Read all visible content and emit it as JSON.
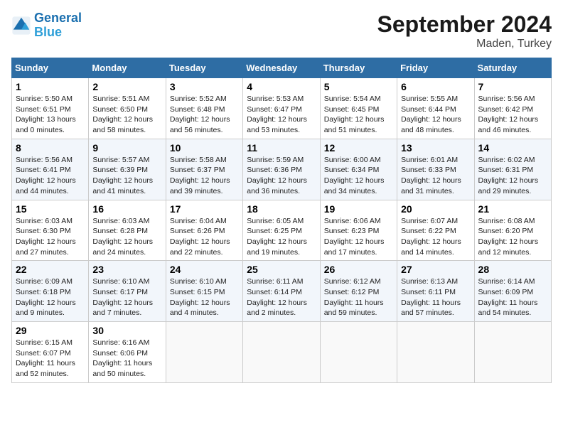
{
  "header": {
    "logo_line1": "General",
    "logo_line2": "Blue",
    "month_title": "September 2024",
    "location": "Maden, Turkey"
  },
  "days_of_week": [
    "Sunday",
    "Monday",
    "Tuesday",
    "Wednesday",
    "Thursday",
    "Friday",
    "Saturday"
  ],
  "weeks": [
    [
      {
        "num": "1",
        "rise": "5:50 AM",
        "set": "6:51 PM",
        "daylight": "13 hours and 0 minutes."
      },
      {
        "num": "2",
        "rise": "5:51 AM",
        "set": "6:50 PM",
        "daylight": "12 hours and 58 minutes."
      },
      {
        "num": "3",
        "rise": "5:52 AM",
        "set": "6:48 PM",
        "daylight": "12 hours and 56 minutes."
      },
      {
        "num": "4",
        "rise": "5:53 AM",
        "set": "6:47 PM",
        "daylight": "12 hours and 53 minutes."
      },
      {
        "num": "5",
        "rise": "5:54 AM",
        "set": "6:45 PM",
        "daylight": "12 hours and 51 minutes."
      },
      {
        "num": "6",
        "rise": "5:55 AM",
        "set": "6:44 PM",
        "daylight": "12 hours and 48 minutes."
      },
      {
        "num": "7",
        "rise": "5:56 AM",
        "set": "6:42 PM",
        "daylight": "12 hours and 46 minutes."
      }
    ],
    [
      {
        "num": "8",
        "rise": "5:56 AM",
        "set": "6:41 PM",
        "daylight": "12 hours and 44 minutes."
      },
      {
        "num": "9",
        "rise": "5:57 AM",
        "set": "6:39 PM",
        "daylight": "12 hours and 41 minutes."
      },
      {
        "num": "10",
        "rise": "5:58 AM",
        "set": "6:37 PM",
        "daylight": "12 hours and 39 minutes."
      },
      {
        "num": "11",
        "rise": "5:59 AM",
        "set": "6:36 PM",
        "daylight": "12 hours and 36 minutes."
      },
      {
        "num": "12",
        "rise": "6:00 AM",
        "set": "6:34 PM",
        "daylight": "12 hours and 34 minutes."
      },
      {
        "num": "13",
        "rise": "6:01 AM",
        "set": "6:33 PM",
        "daylight": "12 hours and 31 minutes."
      },
      {
        "num": "14",
        "rise": "6:02 AM",
        "set": "6:31 PM",
        "daylight": "12 hours and 29 minutes."
      }
    ],
    [
      {
        "num": "15",
        "rise": "6:03 AM",
        "set": "6:30 PM",
        "daylight": "12 hours and 27 minutes."
      },
      {
        "num": "16",
        "rise": "6:03 AM",
        "set": "6:28 PM",
        "daylight": "12 hours and 24 minutes."
      },
      {
        "num": "17",
        "rise": "6:04 AM",
        "set": "6:26 PM",
        "daylight": "12 hours and 22 minutes."
      },
      {
        "num": "18",
        "rise": "6:05 AM",
        "set": "6:25 PM",
        "daylight": "12 hours and 19 minutes."
      },
      {
        "num": "19",
        "rise": "6:06 AM",
        "set": "6:23 PM",
        "daylight": "12 hours and 17 minutes."
      },
      {
        "num": "20",
        "rise": "6:07 AM",
        "set": "6:22 PM",
        "daylight": "12 hours and 14 minutes."
      },
      {
        "num": "21",
        "rise": "6:08 AM",
        "set": "6:20 PM",
        "daylight": "12 hours and 12 minutes."
      }
    ],
    [
      {
        "num": "22",
        "rise": "6:09 AM",
        "set": "6:18 PM",
        "daylight": "12 hours and 9 minutes."
      },
      {
        "num": "23",
        "rise": "6:10 AM",
        "set": "6:17 PM",
        "daylight": "12 hours and 7 minutes."
      },
      {
        "num": "24",
        "rise": "6:10 AM",
        "set": "6:15 PM",
        "daylight": "12 hours and 4 minutes."
      },
      {
        "num": "25",
        "rise": "6:11 AM",
        "set": "6:14 PM",
        "daylight": "12 hours and 2 minutes."
      },
      {
        "num": "26",
        "rise": "6:12 AM",
        "set": "6:12 PM",
        "daylight": "11 hours and 59 minutes."
      },
      {
        "num": "27",
        "rise": "6:13 AM",
        "set": "6:11 PM",
        "daylight": "11 hours and 57 minutes."
      },
      {
        "num": "28",
        "rise": "6:14 AM",
        "set": "6:09 PM",
        "daylight": "11 hours and 54 minutes."
      }
    ],
    [
      {
        "num": "29",
        "rise": "6:15 AM",
        "set": "6:07 PM",
        "daylight": "11 hours and 52 minutes."
      },
      {
        "num": "30",
        "rise": "6:16 AM",
        "set": "6:06 PM",
        "daylight": "11 hours and 50 minutes."
      },
      null,
      null,
      null,
      null,
      null
    ]
  ]
}
